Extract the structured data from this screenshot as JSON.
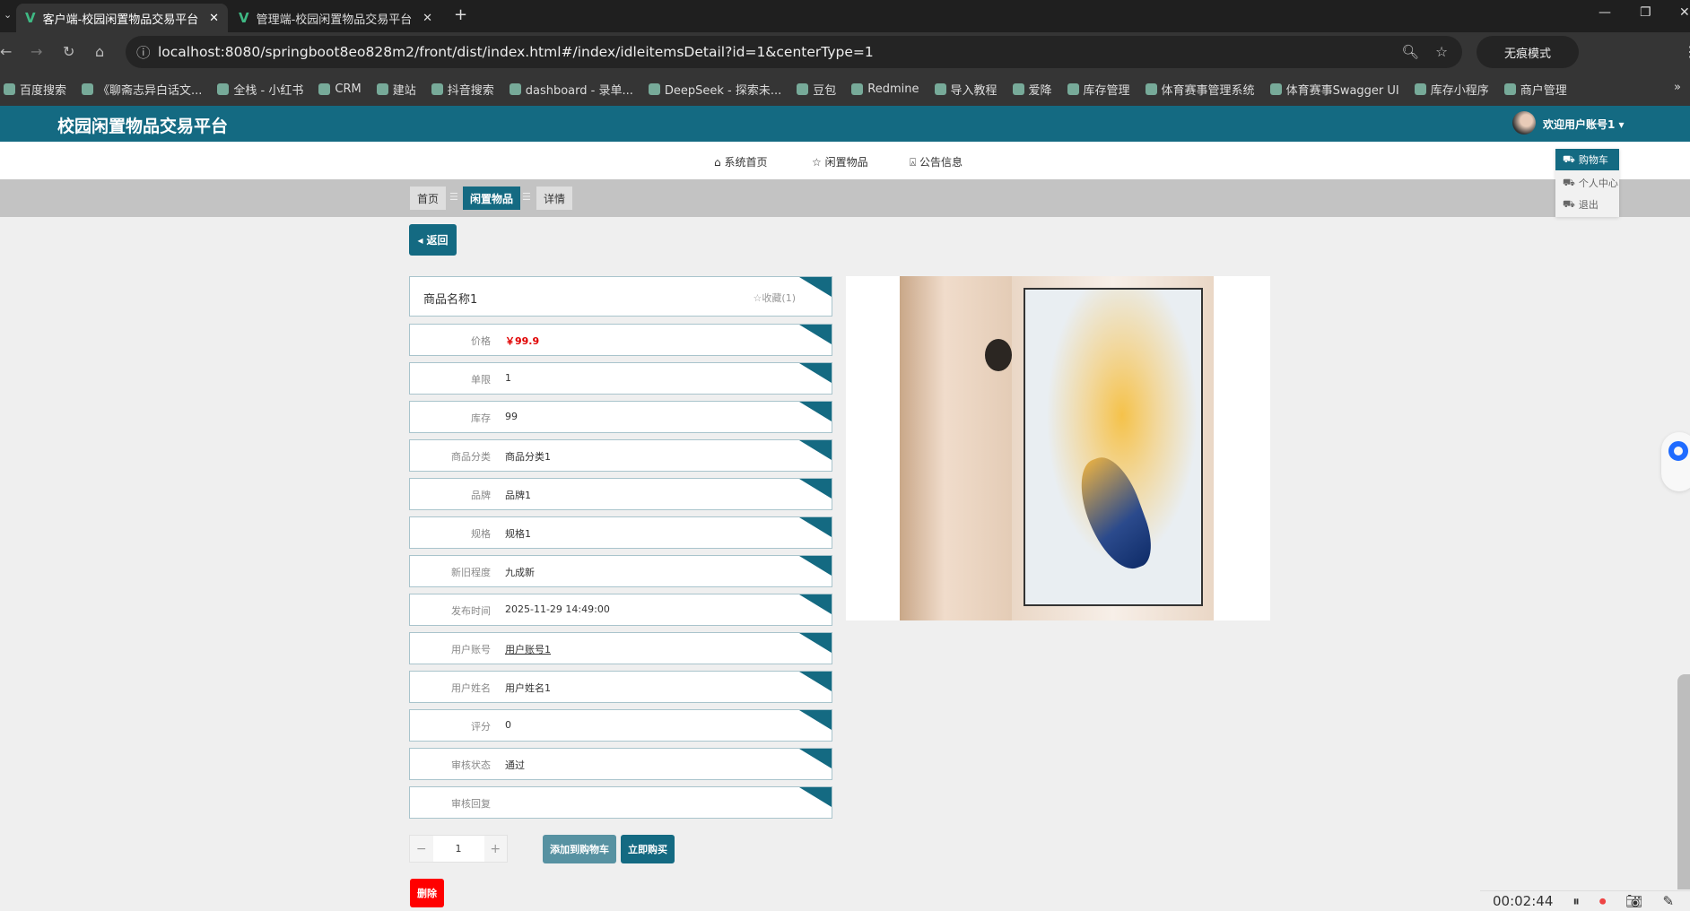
{
  "browser": {
    "tabs": [
      {
        "label": "客户端-校园闲置物品交易平台",
        "active": true
      },
      {
        "label": "管理端-校园闲置物品交易平台",
        "active": false
      }
    ],
    "url": "localhost:8080/springboot8eo828m2/front/dist/index.html#/index/idleitemsDetail?id=1&centerType=1",
    "incognito_label": "无痕模式",
    "bookmarks": [
      "百度搜索",
      "《聊斋志异白话文...",
      "全栈 - 小红书",
      "CRM",
      "建站",
      "抖音搜索",
      "dashboard - 录单...",
      "DeepSeek - 探索未...",
      "豆包",
      "Redmine",
      "导入教程",
      "爱降",
      "库存管理",
      "体育赛事管理系统",
      "体育赛事Swagger UI",
      "库存小程序",
      "商户管理"
    ]
  },
  "header": {
    "title": "校园闲置物品交易平台",
    "welcome": "欢迎用户账号1 ▾"
  },
  "user_menu": [
    "购物车",
    "个人中心",
    "退出"
  ],
  "nav": [
    "系统首页",
    "闲置物品",
    "公告信息"
  ],
  "breadcrumb": [
    "首页",
    "闲置物品",
    "详情"
  ],
  "back_label": "返回",
  "product": {
    "name": "商品名称1",
    "favorite": "☆收藏(1)",
    "fields": [
      {
        "label": "价格",
        "value": "￥99.9"
      },
      {
        "label": "单限",
        "value": "1"
      },
      {
        "label": "库存",
        "value": "99"
      },
      {
        "label": "商品分类",
        "value": "商品分类1"
      },
      {
        "label": "品牌",
        "value": "品牌1"
      },
      {
        "label": "规格",
        "value": "规格1"
      },
      {
        "label": "新旧程度",
        "value": "九成新"
      },
      {
        "label": "发布时间",
        "value": "2025-11-29 14:49:00"
      },
      {
        "label": "用户账号",
        "value": "用户账号1"
      },
      {
        "label": "用户姓名",
        "value": "用户姓名1"
      },
      {
        "label": "评分",
        "value": "0"
      },
      {
        "label": "审核状态",
        "value": "通过"
      },
      {
        "label": "审核回复",
        "value": ""
      }
    ]
  },
  "quantity": {
    "minus": "−",
    "value": "1",
    "plus": "+"
  },
  "actions": {
    "add_cart": "添加到购物车",
    "buy_now": "立即购买",
    "delete": "删除"
  },
  "recorder": {
    "time": "00:02:44"
  },
  "colors": {
    "primary": "#146a82",
    "price": "#e00000",
    "delete": "#ff0000"
  }
}
